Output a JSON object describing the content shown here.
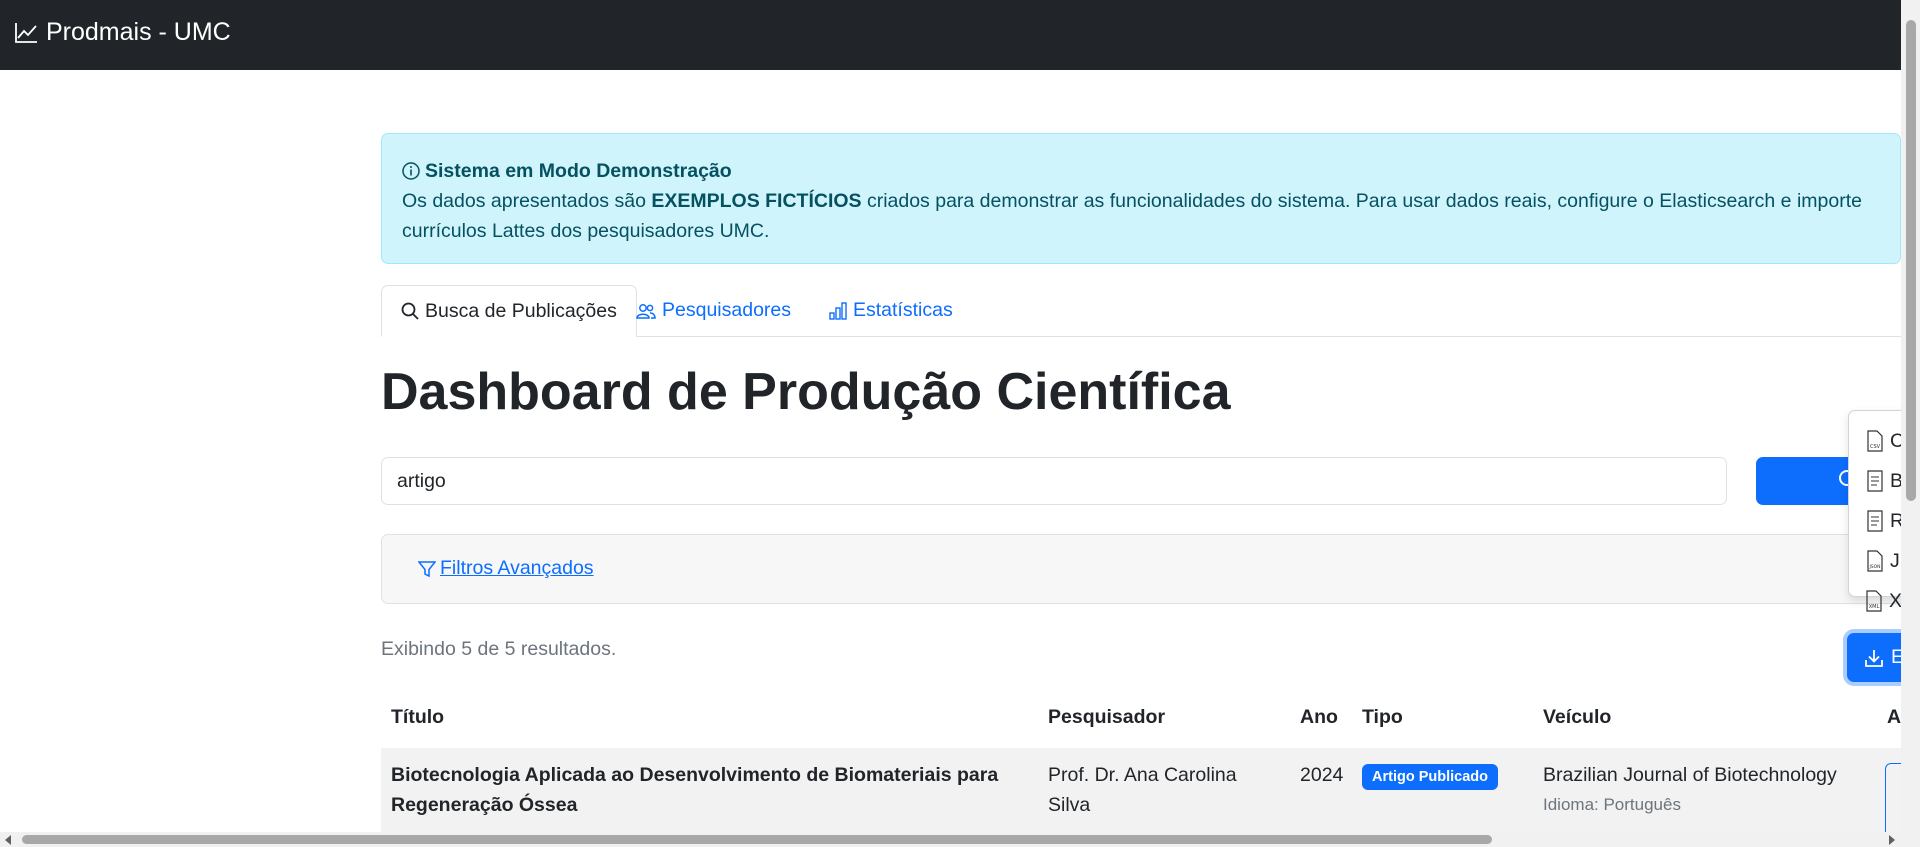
{
  "navbar": {
    "brand": "Prodmais - UMC",
    "brand_icon": "graph-up-icon"
  },
  "alert": {
    "title": "Sistema em Modo Demonstração",
    "text_before": "Os dados apresentados são ",
    "text_strong": "EXEMPLOS FICTÍCIOS",
    "text_after": " criados para demonstrar as funcionalidades do sistema. Para usar dados reais, configure o Elasticsearch e importe currículos Lattes dos pesquisadores UMC."
  },
  "tabs": [
    {
      "label": "Busca de Publicações",
      "icon": "search-icon",
      "active": true
    },
    {
      "label": "Pesquisadores",
      "icon": "people-icon",
      "active": false
    },
    {
      "label": "Estatísticas",
      "icon": "bar-chart-icon",
      "active": false
    }
  ],
  "page_title": "Dashboard de Produção Científica",
  "search": {
    "value": "artigo"
  },
  "filters": {
    "label": " Filtros Avançados"
  },
  "results_text": "Exibindo 5 de 5 resultados.",
  "table": {
    "columns": [
      "Título",
      "Pesquisador",
      "Ano",
      "Tipo",
      "Veículo",
      "A"
    ],
    "rows": [
      {
        "title": "Biotecnologia Aplicada ao Desenvolvimento de Biomateriais para Regeneração Óssea",
        "researcher": "Prof. Dr. Ana Carolina Silva",
        "year": "2024",
        "type": "Artigo Publicado",
        "venue": "Brazilian Journal of Biotechnology",
        "language": "Idioma: Português"
      }
    ]
  },
  "export": {
    "button_label": "Ex",
    "menu": [
      {
        "label": "C",
        "icon": "csv-file-icon"
      },
      {
        "label": "B",
        "icon": "text-file-icon"
      },
      {
        "label": "R",
        "icon": "text-file-icon"
      },
      {
        "label": "J",
        "icon": "json-file-icon"
      },
      {
        "label": "X",
        "icon": "xml-file-icon"
      }
    ]
  },
  "colors": {
    "navbar": "#212529",
    "primary": "#0d6efd",
    "alert_bg": "#cff4fc",
    "alert_text": "#055160"
  }
}
